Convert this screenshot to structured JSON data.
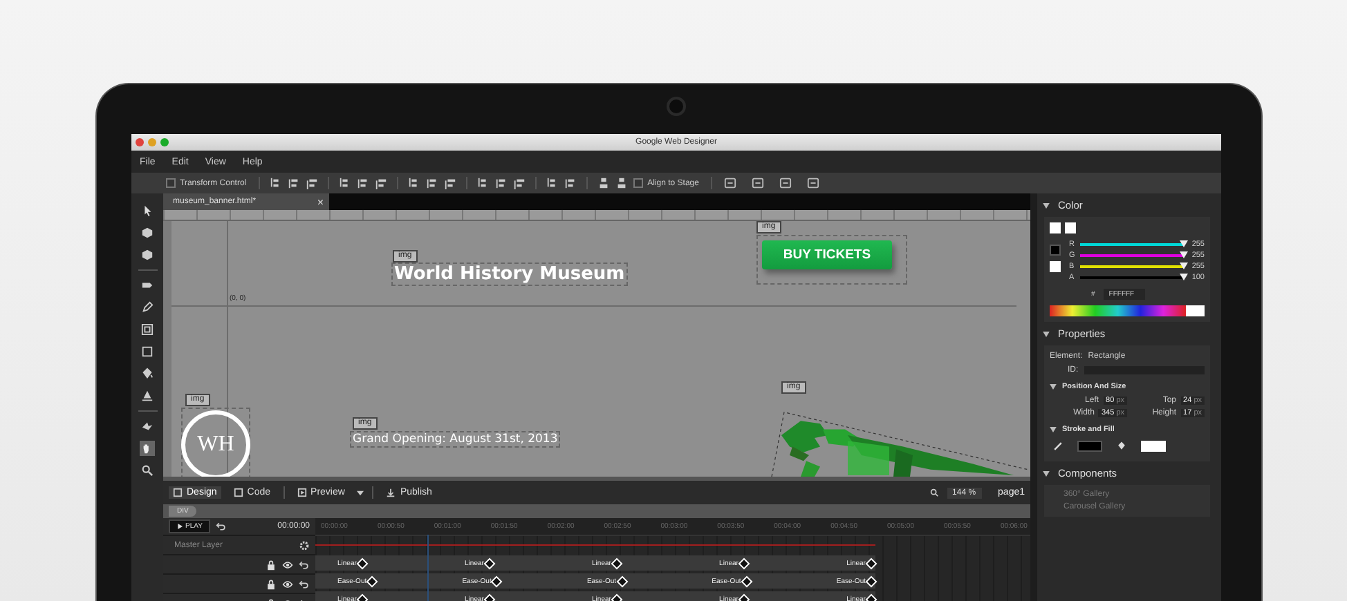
{
  "window": {
    "title": "Google Web Designer"
  },
  "menu": [
    "File",
    "Edit",
    "View",
    "Help"
  ],
  "toolbar": {
    "transform_control": {
      "label": "Transform Control",
      "checked": false
    },
    "align_to_stage": {
      "label": "Align to Stage",
      "checked": false
    }
  },
  "document_tab": {
    "title": "museum_banner.html*",
    "close": "×"
  },
  "canvas": {
    "origin": "(0, 0)",
    "elements": [
      {
        "kind": "heading",
        "tag": "img",
        "text": "World History Museum"
      },
      {
        "kind": "button",
        "tag": "img",
        "text": "BUY TICKETS"
      },
      {
        "kind": "logo",
        "tag": "img",
        "text": "WH"
      },
      {
        "kind": "caption",
        "tag": "img",
        "text": "Grand Opening: August 31st, 2013"
      },
      {
        "kind": "picture",
        "tag": "img"
      }
    ]
  },
  "bottom_bar": {
    "modes": [
      {
        "label": "Design",
        "selected": true
      },
      {
        "label": "Code",
        "selected": false
      }
    ],
    "preview": "Preview",
    "publish": "Publish",
    "zoom": "144 %",
    "page": "page1"
  },
  "breadcrumb": "DIV",
  "timeline": {
    "play": "PLAY",
    "time": "00:00:00",
    "ticks": [
      "00:00:00",
      "00:00:50",
      "00:01:00",
      "00:01:50",
      "00:02:00",
      "00:02:50",
      "00:03:00",
      "00:03:50",
      "00:04:00",
      "00:04:50",
      "00:05:00",
      "00:05:50",
      "00:06:00"
    ],
    "master_layer": "Master Layer",
    "layers": [
      {
        "keyframes": [
          "Linear",
          "Linear",
          "Linear",
          "Linear",
          "Linear"
        ]
      },
      {
        "keyframes": [
          "Ease-Out",
          "Ease-Out",
          "Ease-Out",
          "Ease-Out",
          "Ease-Out"
        ]
      },
      {
        "keyframes": [
          "Linear",
          "Linear",
          "Linear",
          "Linear",
          "Linear"
        ]
      }
    ]
  },
  "color_panel": {
    "title": "Color",
    "channels": [
      {
        "name": "R",
        "value": "255",
        "level": 1,
        "color": "#00d8d8"
      },
      {
        "name": "G",
        "value": "255",
        "level": 1,
        "color": "#e000e0"
      },
      {
        "name": "B",
        "value": "255",
        "level": 1,
        "color": "#e0e000"
      },
      {
        "name": "A",
        "value": "100",
        "level": 1,
        "color": "#000000"
      }
    ],
    "hex_label": "#",
    "hex": "FFFFFF"
  },
  "properties_panel": {
    "title": "Properties",
    "element_label": "Element:",
    "element": "Rectangle",
    "id_label": "ID:",
    "position_title": "Position And Size",
    "fields": [
      {
        "label": "Left",
        "value": "80",
        "unit": "px"
      },
      {
        "label": "Top",
        "value": "24",
        "unit": "px"
      },
      {
        "label": "Width",
        "value": "345",
        "unit": "px"
      },
      {
        "label": "Height",
        "value": "17",
        "unit": "px"
      }
    ],
    "stroke_title": "Stroke and Fill"
  },
  "components_panel": {
    "title": "Components",
    "items": [
      "360° Gallery",
      "Carousel Gallery"
    ]
  }
}
